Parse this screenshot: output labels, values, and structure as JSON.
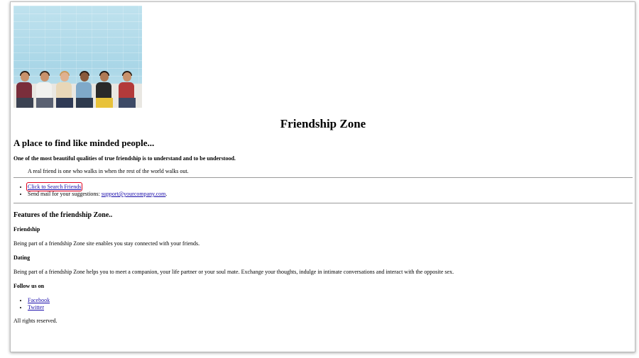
{
  "hero": {
    "alt": "Group of friends sitting on a sofa"
  },
  "page": {
    "title": "Friendship Zone",
    "tagline": "A place to find like minded people...",
    "quote_bold": "One of the most beautiful qualities of true friendship is to understand and to be understood.",
    "quote": "A real friend is one who walks in when the rest of the world walks out."
  },
  "links": {
    "search_label": "Click to Search Friends",
    "mail_prefix": "Send mail for your suggestions: ",
    "mail_address": "support@yourcompany.com",
    "mail_suffix": "."
  },
  "features": {
    "heading": "Features of the friendship Zone..",
    "items": [
      {
        "title": "Friendship",
        "text": "Being part of a friendship Zone site enables you stay connected with your friends."
      },
      {
        "title": "Dating",
        "text": "Being part of a friendship Zone helps you to meet a companion, your life partner or your soul mate. Exchange your thoughts, indulge in intimate conversations and interact with the opposite sex."
      }
    ]
  },
  "social": {
    "heading": "Follow us on",
    "items": [
      "Facebook",
      "Twitter"
    ]
  },
  "footer": {
    "text": "All rights reserved."
  },
  "colors": {
    "link": "#1a0dab",
    "highlight": "#e0001b",
    "hero_sky": "#a9d6e7"
  }
}
